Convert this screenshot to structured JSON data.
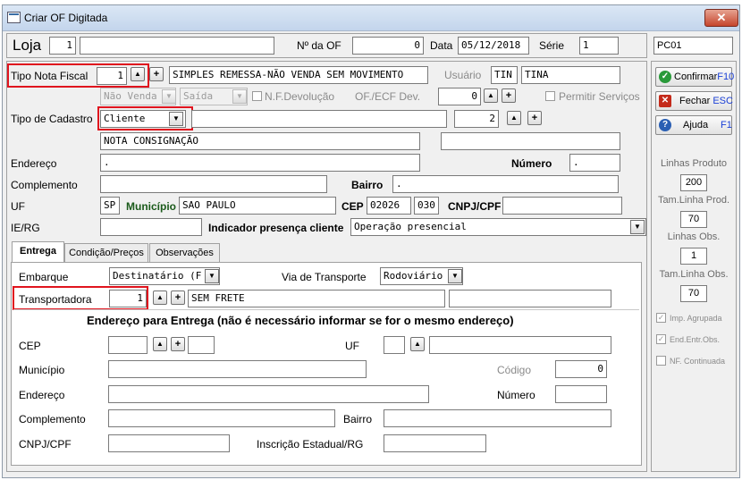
{
  "window": {
    "title": "Criar OF Digitada",
    "close": "✕"
  },
  "header": {
    "loja_label": "Loja",
    "loja_code": "1",
    "loja_name": "",
    "nof_label": "Nº da OF",
    "nof_value": "0",
    "data_label": "Data",
    "data_value": "05/12/2018",
    "serie_label": "Série",
    "serie_value": "1",
    "terminal": "PC01"
  },
  "nota": {
    "tipo_label": "Tipo Nota Fiscal",
    "tipo_code": "1",
    "tipo_desc": "SIMPLES REMESSA-NÃO VENDA SEM MOVIMENTO",
    "usuario_label": "Usuário",
    "usuario_code": "TIN",
    "usuario_name": "TINA",
    "venda_value": "Não Venda",
    "saida_value": "Saída",
    "devolucao_label": "N.F.Devolução",
    "of_ecf_label": "OF./ECF Dev.",
    "of_ecf_value": "0",
    "permitir_label": "Permitir Serviços"
  },
  "cadastro": {
    "tipo_label": "Tipo de Cadastro",
    "tipo_value": "Cliente",
    "tipo_name": "",
    "code": "2",
    "nome1": "NOTA CONSIGNAÇÃO",
    "nome2": "",
    "endereco_label": "Endereço",
    "endereco_value": ".",
    "numero_label": "Número",
    "numero_value": ".",
    "complemento_label": "Complemento",
    "complemento_value": "",
    "bairro_label": "Bairro",
    "bairro_value": ".",
    "uf_label": "UF",
    "uf_value": "SP",
    "municipio_label": "Município",
    "municipio_value": "SAO PAULO",
    "cep_label": "CEP",
    "cep_value1": "02026",
    "cep_value2": "030",
    "cnpj_label": "CNPJ/CPF",
    "cnpj_value": "",
    "ie_label": "IE/RG",
    "ie_value": "",
    "presenca_label": "Indicador presença cliente",
    "presenca_value": "Operação presencial"
  },
  "tabs": [
    {
      "label": "Entrega"
    },
    {
      "label": "Condição/Preços"
    },
    {
      "label": "Observações"
    }
  ],
  "entrega": {
    "embarque_label": "Embarque",
    "embarque_value": "Destinatário (F",
    "via_label": "Via de Transporte",
    "via_value": "Rodoviário",
    "transp_label": "Transportadora",
    "transp_code": "1",
    "transp_name": "SEM FRETE",
    "transp_extra": "",
    "section_title": "Endereço para Entrega (não é necessário informar se for o mesmo endereço)",
    "cep_label": "CEP",
    "uf_label": "UF",
    "municipio_label": "Município",
    "codigo_label": "Código",
    "codigo_value": "0",
    "endereco_label": "Endereço",
    "numero_label": "Número",
    "complemento_label": "Complemento",
    "bairro_label": "Bairro",
    "cnpj_label": "CNPJ/CPF",
    "ie_label": "Inscrição Estadual/RG"
  },
  "side": {
    "confirmar_label": "Confirmar",
    "confirmar_key": "F10",
    "fechar_label": "Fechar",
    "fechar_key": "ESC",
    "ajuda_label": "Ajuda",
    "ajuda_key": "F1",
    "linhas_produto_label": "Linhas Produto",
    "linhas_produto_value": "200",
    "tam_linha_prod_label": "Tam.Linha Prod.",
    "tam_linha_prod_value": "70",
    "linhas_obs_label": "Linhas Obs.",
    "linhas_obs_value": "1",
    "tam_linha_obs_label": "Tam.Linha Obs.",
    "tam_linha_obs_value": "70",
    "imp_agrupada_label": "Imp. Agrupada",
    "end_entr_obs_label": "End.Entr.Obs.",
    "nf_continuada_label": "NF. Continuada"
  },
  "icons": {
    "up": "▲",
    "plus": "+",
    "down": "▼",
    "check": "✓"
  },
  "colors": {
    "highlight": "#e0141e",
    "confirm": "#2a9a3a",
    "close": "#c42a1a",
    "help": "#2a5fb3",
    "hotkey": "#1a3fd6"
  }
}
